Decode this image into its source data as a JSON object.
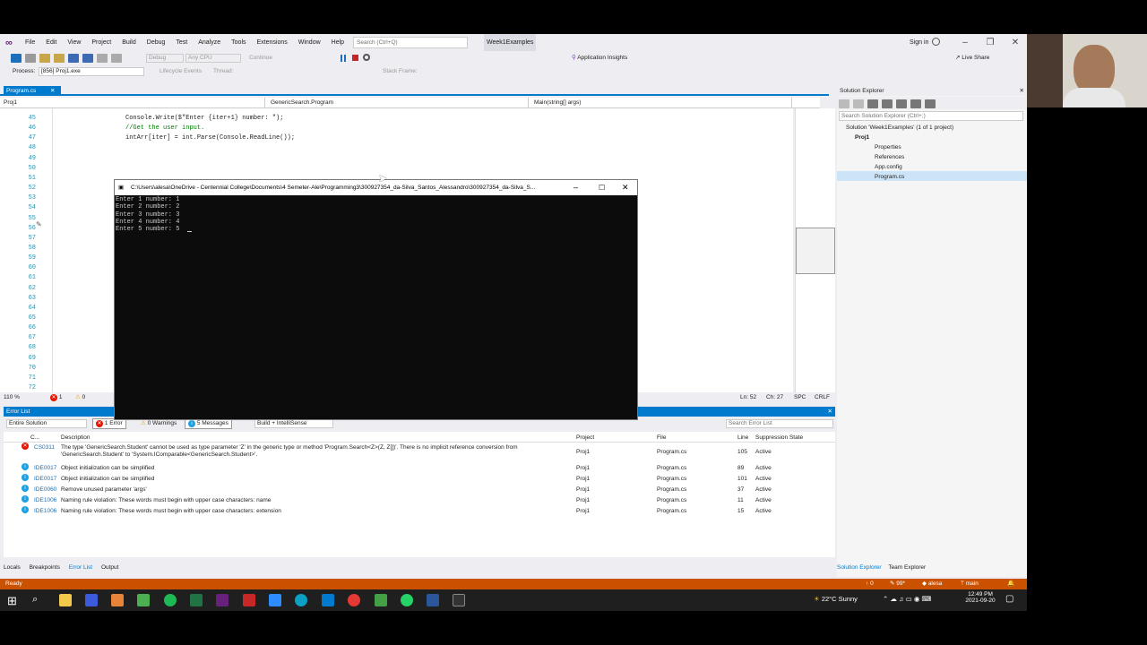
{
  "menu": {
    "items": [
      "File",
      "Edit",
      "View",
      "Project",
      "Build",
      "Debug",
      "Test",
      "Analyze",
      "Tools",
      "Extensions",
      "Window",
      "Help"
    ],
    "search_placeholder": "Search (Ctrl+Q)",
    "solution_name": "Week1Examples",
    "sign_in": "Sign in"
  },
  "toolbar": {
    "config": "Debug",
    "platform": "Any CPU",
    "continue": "Continue",
    "app_insights": "Application Insights",
    "live_share": "Live Share"
  },
  "toolbar2": {
    "process_label": "Process:",
    "process_value": "[856] Proj1.exe",
    "lifecycle": "Lifecycle Events",
    "thread": "Thread:",
    "stack_frame": "Stack Frame:"
  },
  "document": {
    "tab": "Program.cs",
    "nav_project": "Proj1",
    "nav_class": "GenericSearch.Program",
    "nav_member": "Main(string[] args)"
  },
  "editor": {
    "line_numbers": [
      "45",
      "46",
      "47",
      "48",
      "49",
      "50",
      "51",
      "52",
      "53",
      "54",
      "55",
      "56",
      "57",
      "58",
      "59",
      "60",
      "61",
      "62",
      "63",
      "64",
      "65",
      "66",
      "67",
      "68",
      "69",
      "70",
      "71",
      "72"
    ],
    "code_lines": [
      "Console.Write($\"Enter {iter+1} number: \");",
      "//Get the user input.",
      "intArr[iter] = int.Parse(Console.ReadLine());"
    ],
    "zoom": "110 %",
    "errors_count": "1",
    "warnings_count": "0",
    "position": "Ln: 52",
    "column": "Ch: 27",
    "spc": "SPC",
    "crlf": "CRLF"
  },
  "console": {
    "title": "C:\\Users\\alesa\\OneDrive - Centennial College\\Documents\\4 Semeter-Ale\\Programming3\\300927354_da-Silva_Santos_Alessandro\\300927354_da-Silva_S...",
    "output": "Enter 1 number: 1\nEnter 2 number: 2\nEnter 3 number: 3\nEnter 4 number: 4\nEnter 5 number: 5"
  },
  "error_list": {
    "title": "Error List",
    "scope": "Entire Solution",
    "errors_btn": "1 Error",
    "warnings_btn": "0 Warnings",
    "messages_btn": "5 Messages",
    "build_filter": "Build + IntelliSense",
    "search_placeholder": "Search Error List",
    "headers": {
      "code": "C...",
      "description": "Description",
      "project": "Project",
      "file": "File",
      "line": "Line",
      "state": "Suppression State"
    },
    "rows": [
      {
        "code": "CS0311",
        "kind": "error",
        "description": "The type 'GenericSearch.Student' cannot be used as type parameter 'Z' in the generic type or method 'Program.Search<Z>(Z, Z[])'. There is no implicit reference conversion from",
        "description2": "'GenericSearch.Student' to 'System.IComparable<GenericSearch.Student>'.",
        "project": "Proj1",
        "file": "Program.cs",
        "line": "105",
        "state": "Active"
      },
      {
        "code": "IDE0017",
        "kind": "info",
        "description": "Object initialization can be simplified",
        "project": "Proj1",
        "file": "Program.cs",
        "line": "89",
        "state": "Active"
      },
      {
        "code": "IDE0017",
        "kind": "info",
        "description": "Object initialization can be simplified",
        "project": "Proj1",
        "file": "Program.cs",
        "line": "101",
        "state": "Active"
      },
      {
        "code": "IDE0060",
        "kind": "info",
        "description": "Remove unused parameter 'args'",
        "project": "Proj1",
        "file": "Program.cs",
        "line": "37",
        "state": "Active"
      },
      {
        "code": "IDE1006",
        "kind": "info",
        "description": "Naming rule violation: These words must begin with upper case characters: name",
        "project": "Proj1",
        "file": "Program.cs",
        "line": "11",
        "state": "Active"
      },
      {
        "code": "IDE1006",
        "kind": "info",
        "description": "Naming rule violation: These words must begin with upper case characters: extension",
        "project": "Proj1",
        "file": "Program.cs",
        "line": "15",
        "state": "Active"
      }
    ]
  },
  "bottom_tabs": [
    "Locals",
    "Breakpoints",
    "Error List",
    "Output"
  ],
  "solution_explorer": {
    "title": "Solution Explorer",
    "search_placeholder": "Search Solution Explorer (Ctrl+;)",
    "items": [
      "Solution 'Week1Examples' (1 of 1 project)",
      "Proj1",
      "Properties",
      "References",
      "App.config",
      "Program.cs"
    ],
    "tabs": [
      "Solution Explorer",
      "Team Explorer"
    ]
  },
  "statusbar": {
    "ready": "Ready",
    "errors": "0",
    "pencil": "99*",
    "user": "alesa",
    "branch": "main"
  },
  "taskbar": {
    "weather": "22°C  Sunny",
    "time": "12:49 PM",
    "date": "2021-09-20"
  },
  "colors": {
    "accent": "#007acc",
    "status": "#ca5100",
    "console_bg": "#0c0c0c"
  }
}
